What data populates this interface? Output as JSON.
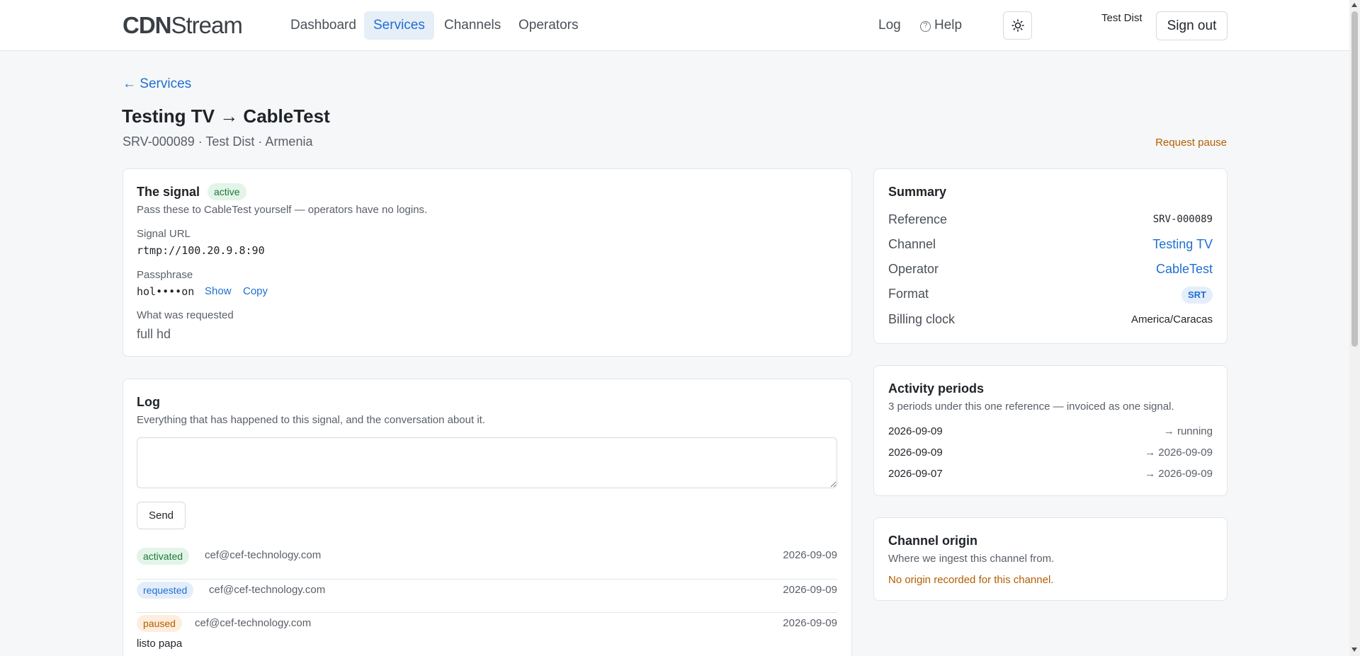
{
  "header": {
    "logo_bold": "CDN",
    "logo_light": "Stream",
    "nav": [
      "Dashboard",
      "Services",
      "Channels",
      "Operators"
    ],
    "active_nav": "Services",
    "log_label": "Log",
    "help_label": "Help",
    "user_name": "Test Dist",
    "signout_label": "Sign out"
  },
  "page": {
    "back_label": "← Services",
    "title": "Testing TV → CableTest",
    "subtitle": "SRV-000089 · Test Dist · Armenia",
    "request_pause": "Request pause"
  },
  "signal": {
    "title": "The signal",
    "status": "active",
    "description": "Pass these to CableTest yourself — operators have no logins.",
    "url_label": "Signal URL",
    "url_value": "rtmp://100.20.9.8:90",
    "pass_label": "Passphrase",
    "pass_value": "hol••••on",
    "show_label": "Show",
    "copy_label": "Copy",
    "requested_label": "What was requested",
    "requested_value": "full hd"
  },
  "log": {
    "title": "Log",
    "description": "Everything that has happened to this signal, and the conversation about it.",
    "input_value": "",
    "send_label": "Send",
    "entries": [
      {
        "status": "activated",
        "color": "green",
        "who": "cef@cef-technology.com",
        "date": "2026-09-09",
        "note": ""
      },
      {
        "status": "requested",
        "color": "blue",
        "who": "cef@cef-technology.com",
        "date": "2026-09-09",
        "note": ""
      },
      {
        "status": "paused",
        "color": "orange",
        "who": "cef@cef-technology.com",
        "date": "2026-09-09",
        "note": "listo papa"
      }
    ]
  },
  "summary": {
    "title": "Summary",
    "reference_label": "Reference",
    "reference_value": "SRV-000089",
    "channel_label": "Channel",
    "channel_value": "Testing TV",
    "operator_label": "Operator",
    "operator_value": "CableTest",
    "format_label": "Format",
    "format_value": "SRT",
    "billing_label": "Billing clock",
    "billing_value": "America/Caracas"
  },
  "periods": {
    "title": "Activity periods",
    "description": "3 periods under this one reference — invoiced as one signal.",
    "rows": [
      {
        "start": "2026-09-09",
        "end": "→ running"
      },
      {
        "start": "2026-09-09",
        "end": "→ 2026-09-09"
      },
      {
        "start": "2026-09-07",
        "end": "→ 2026-09-09"
      }
    ]
  },
  "origin": {
    "title": "Channel origin",
    "description": "Where we ingest this channel from.",
    "warning": "No origin recorded for this channel."
  },
  "colors": {
    "accent": "#1f6fd1",
    "warning": "#b45d00",
    "success": "#1d7a3a"
  }
}
